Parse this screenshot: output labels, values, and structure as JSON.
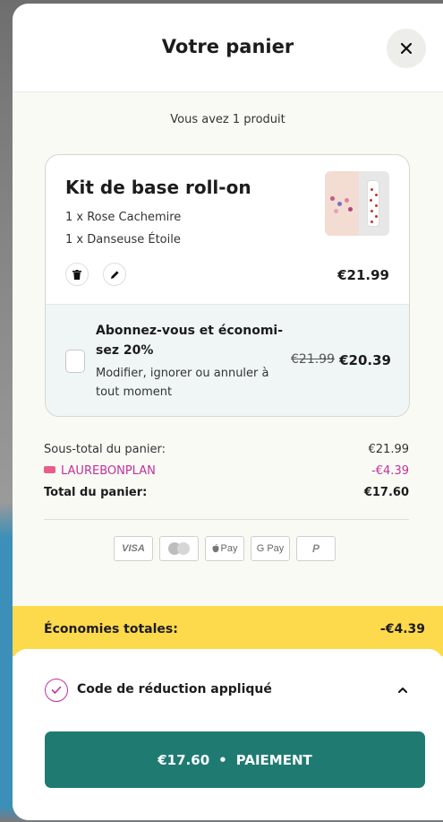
{
  "cart": {
    "title": "Votre panier",
    "count_text": "Vous avez 1 produit"
  },
  "icons": {
    "close": "close-icon",
    "trash": "trash-icon",
    "edit": "pencil-icon",
    "coupon": "tag-icon",
    "applied": "checkmark-icon",
    "collapse": "chevron-up-icon"
  },
  "item": {
    "name": "Kit de base roll-on",
    "variants": [
      "1 x Rose Cachemire",
      "1 x Danseuse Étoile"
    ],
    "price": "€21.99"
  },
  "subscription": {
    "title": "Abonnez-vous et économi-sez 20%",
    "description": "Modifier, ignorer ou annuler à tout moment",
    "old_price": "€21.99",
    "new_price": "€20.39",
    "checked": false
  },
  "summary": {
    "subtotal_label": "Sous-total du panier:",
    "subtotal_value": "€21.99",
    "code_label": "LAUREBONPLAN",
    "code_value": "-€4.39",
    "total_label": "Total du panier:",
    "total_value": "€17.60"
  },
  "payment_methods": [
    "VISA",
    "Mastercard",
    "Apple Pay",
    "G Pay",
    "PayPal"
  ],
  "payment_labels": {
    "visa": "VISA",
    "apple": "Pay",
    "gpay": "G Pay",
    "paypal": "P"
  },
  "savings": {
    "label": "Économies totales:",
    "value": "-€4.39"
  },
  "discount": {
    "label": "Code de réduction appliqué"
  },
  "checkout": {
    "amount": "€17.60",
    "separator": "•",
    "label": "PAIEMENT"
  },
  "colors": {
    "accent_green": "#1f7b72",
    "savings_yellow": "#fdd94c",
    "code_pink": "#c2319a"
  }
}
